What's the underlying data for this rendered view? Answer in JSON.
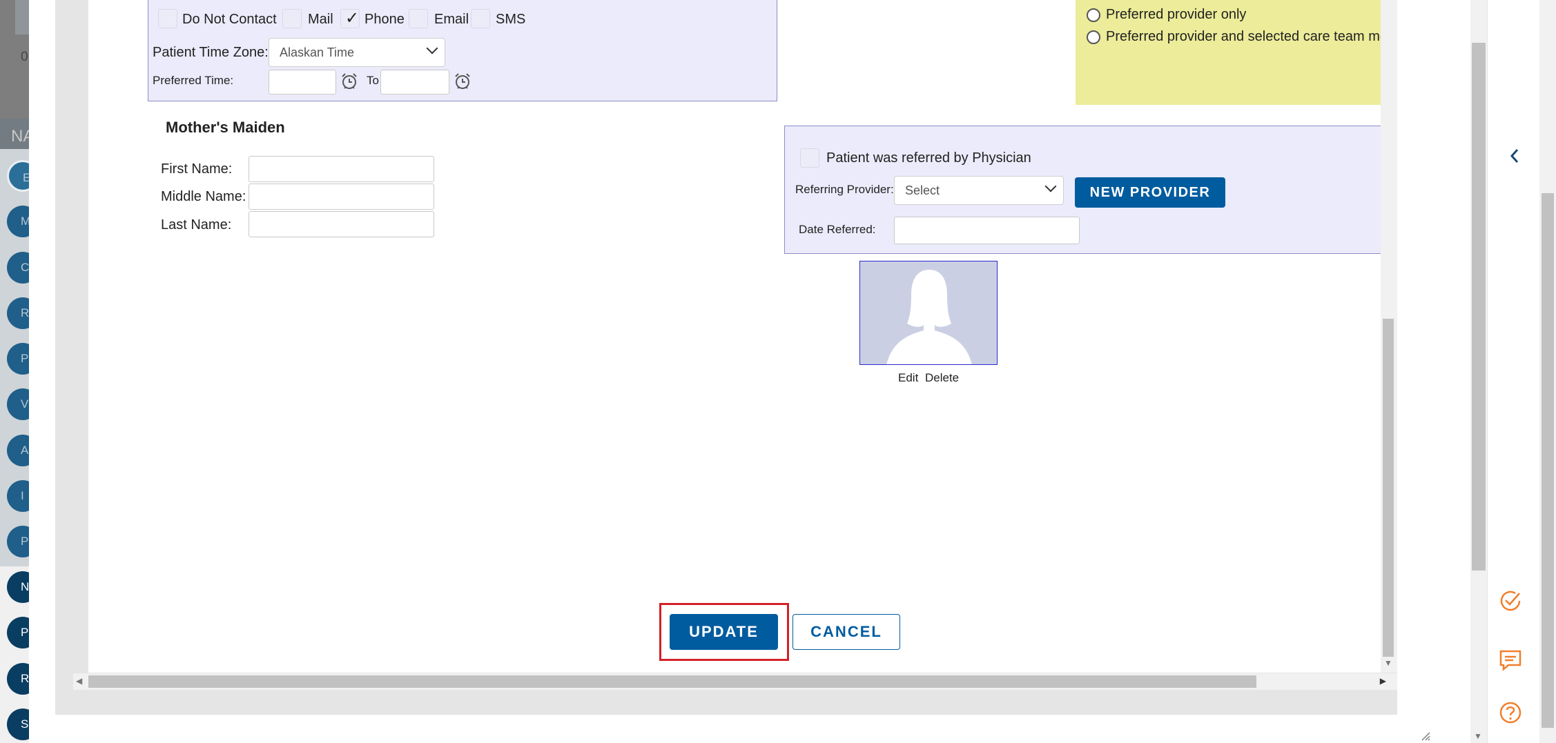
{
  "background_app": {
    "count_text": "0",
    "header_text": "NA",
    "circle_items": [
      "E",
      "M",
      "CS",
      "RC",
      "P",
      "V",
      "A",
      "I",
      "PD",
      "N",
      "P",
      "R",
      "S"
    ]
  },
  "contact_prefs": {
    "checkboxes": [
      {
        "label": "Do Not Contact",
        "checked": false
      },
      {
        "label": "Mail",
        "checked": false
      },
      {
        "label": "Phone",
        "checked": true
      },
      {
        "label": "Email",
        "checked": false
      },
      {
        "label": "SMS",
        "checked": false
      }
    ],
    "time_zone_label": "Patient Time Zone:",
    "time_zone_value": "Alaskan Time",
    "preferred_time_label": "Preferred Time:",
    "to_label": "To",
    "from_value": "",
    "to_value": ""
  },
  "provider_pref": {
    "options": [
      {
        "label": "Preferred provider only",
        "selected": false
      },
      {
        "label": "Preferred provider and selected care team me",
        "selected": false
      }
    ]
  },
  "mothers_maiden": {
    "title": "Mother's Maiden",
    "first_label": "First Name:",
    "middle_label": "Middle Name:",
    "last_label": "Last Name:",
    "first_value": "",
    "middle_value": "",
    "last_value": ""
  },
  "referral": {
    "checkbox_label": "Patient was referred by Physician",
    "checked": false,
    "provider_label": "Referring Provider:",
    "provider_value": "Select",
    "new_provider_button": "NEW PROVIDER",
    "date_label": "Date Referred:",
    "date_value": ""
  },
  "photo": {
    "edit_label": "Edit",
    "delete_label": "Delete"
  },
  "actions": {
    "update_label": "UPDATE",
    "cancel_label": "CANCEL"
  },
  "colors": {
    "primary": "#005c9f",
    "highlight": "#d42027",
    "section_bg": "#ebebfb",
    "notice_bg": "#ecec9a",
    "side_icon": "#f07f2b"
  },
  "icons": {
    "alarm": "alarm-clock-icon",
    "collapse": "chevron-left-icon",
    "tasks": "check-circle-icon",
    "messages": "chat-icon",
    "help": "question-circle-icon"
  }
}
